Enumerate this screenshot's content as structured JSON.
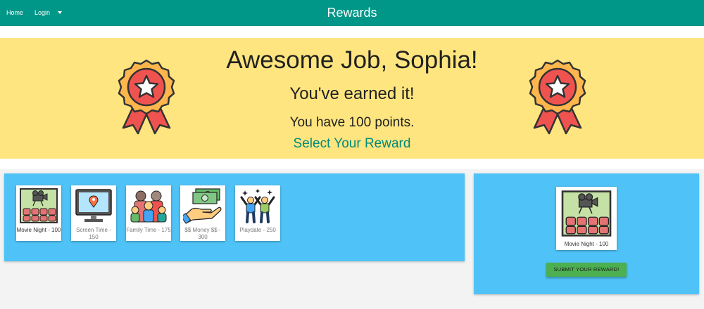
{
  "nav": {
    "home_label": "Home",
    "login_label": "Login",
    "title": "Rewards"
  },
  "banner": {
    "headline": "Awesome Job, Sophia!",
    "subline": "You've earned it!",
    "points_text": "You have 100 points.",
    "select_link": "Select Your Reward",
    "icon": "award-ribbon-star-icon"
  },
  "rewards": [
    {
      "label": "Movie Night - 100",
      "icon": "movie-night-icon"
    },
    {
      "label": "Screen Time - 150",
      "icon": "screen-time-icon"
    },
    {
      "label": "Family Time - 175",
      "icon": "family-icon"
    },
    {
      "label": "$$ Money $$ - 300",
      "icon": "money-hand-icon"
    },
    {
      "label": "Playdate - 250",
      "icon": "playdate-icon"
    }
  ],
  "selected": {
    "label": "Movie Night - 100",
    "icon": "movie-night-icon"
  },
  "submit_label": "SUBMIT YOUR REWARD!",
  "colors": {
    "navbar": "#009688",
    "banner": "#ffe57f",
    "panel": "#4fc3f7",
    "submit": "#4caf50",
    "link": "#00897b"
  }
}
